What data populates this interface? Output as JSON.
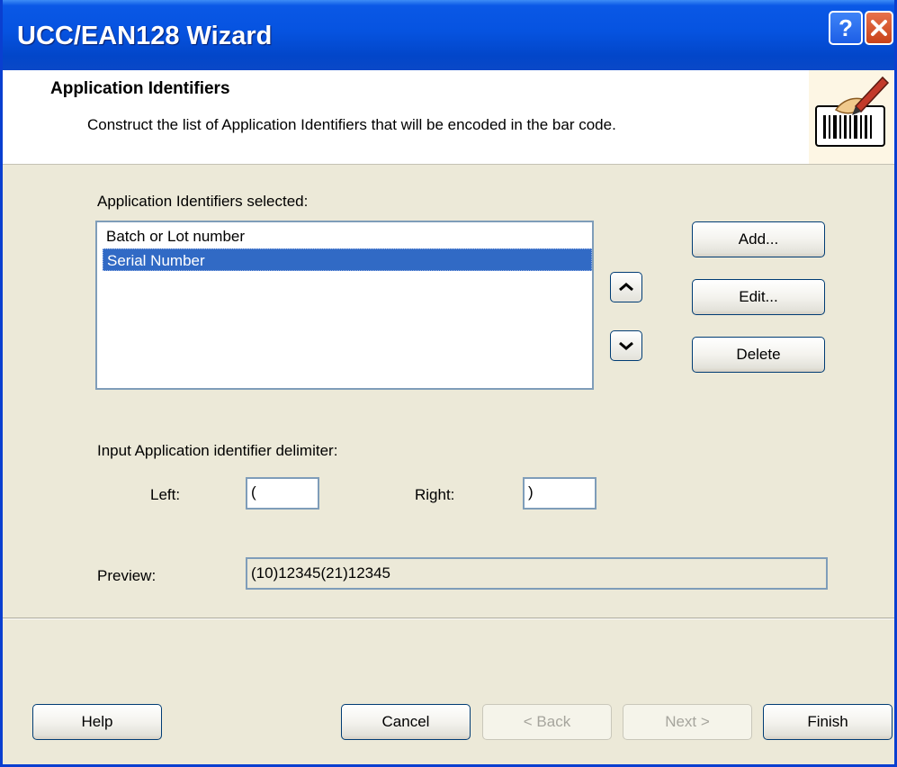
{
  "window": {
    "title": "UCC/EAN128 Wizard"
  },
  "header": {
    "title": "Application Identifiers",
    "subtitle": "Construct the list of Application Identifiers that will be encoded in the bar code."
  },
  "selected_list": {
    "label": "Application Identifiers selected:",
    "items": [
      {
        "label": "Batch or Lot number",
        "selected": false
      },
      {
        "label": "Serial Number",
        "selected": true
      }
    ]
  },
  "side_buttons": {
    "add_label": "Add...",
    "edit_label": "Edit...",
    "delete_label": "Delete"
  },
  "delimiter": {
    "label": "Input Application identifier delimiter:",
    "left_label": "Left:",
    "left_value": "(",
    "right_label": "Right:",
    "right_value": ")"
  },
  "preview": {
    "label": "Preview:",
    "value": "(10)12345(21)12345"
  },
  "footer": {
    "help_label": "Help",
    "cancel_label": "Cancel",
    "back_label": "< Back",
    "next_label": "Next >",
    "finish_label": "Finish"
  },
  "colors": {
    "selection": "#316ac5",
    "titlebar": "#0653e0",
    "dialog_bg": "#ece9d8"
  }
}
